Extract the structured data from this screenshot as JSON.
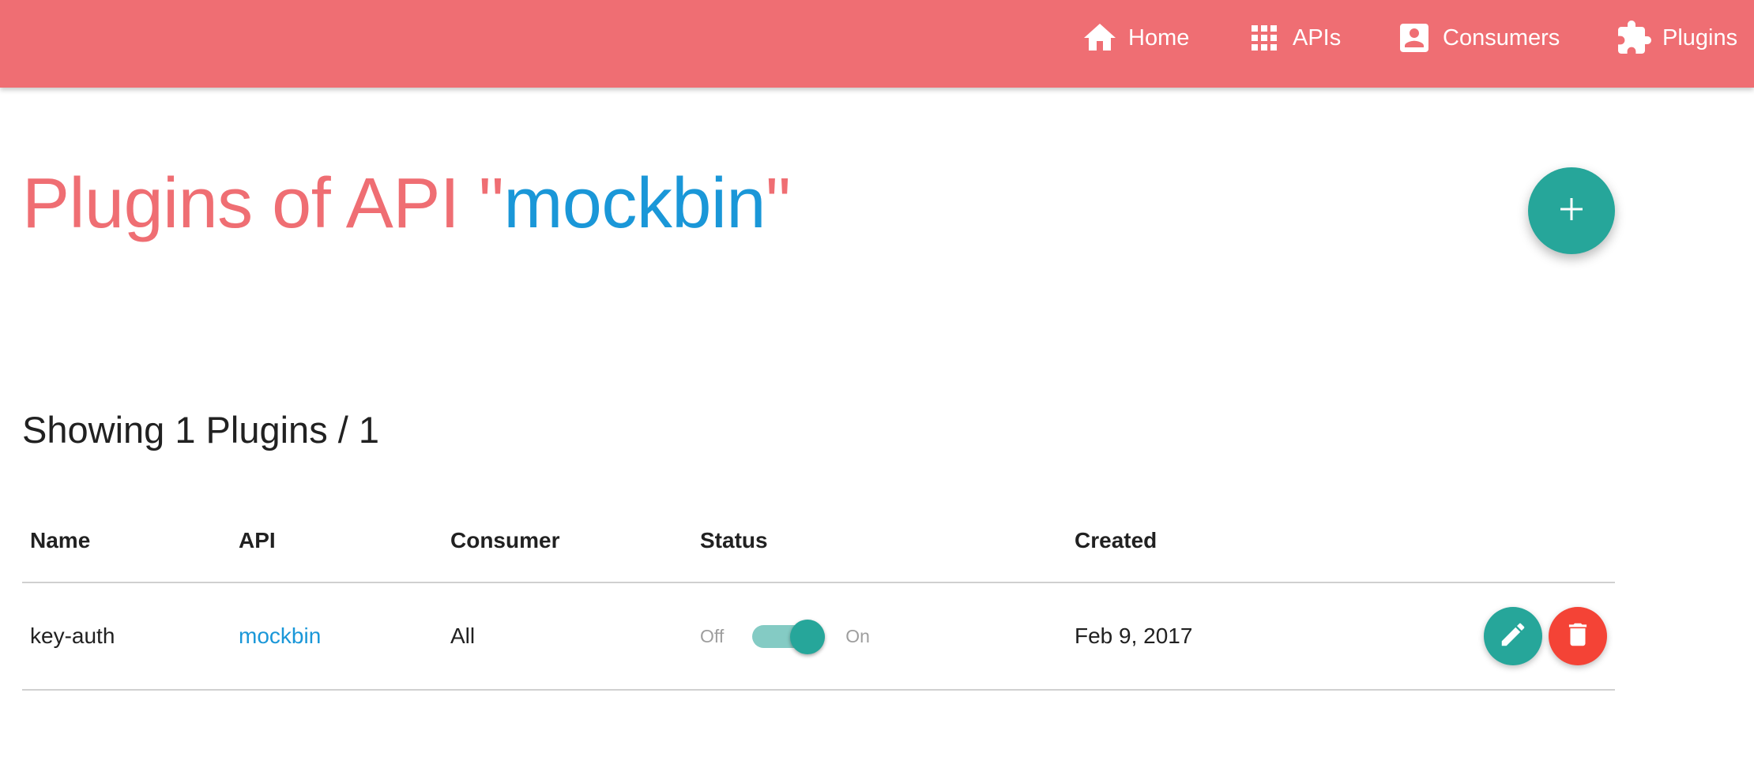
{
  "nav": {
    "items": [
      {
        "label": "Home",
        "icon": "home-icon"
      },
      {
        "label": "APIs",
        "icon": "apps-grid-icon"
      },
      {
        "label": "Consumers",
        "icon": "account-box-icon"
      },
      {
        "label": "Plugins",
        "icon": "puzzle-icon"
      }
    ]
  },
  "page": {
    "title_prefix": "Plugins of API \"",
    "api_name": "mockbin",
    "title_suffix": "\"",
    "add_button_icon": "plus-icon",
    "showing_text": "Showing 1 Plugins / 1"
  },
  "table": {
    "headers": [
      "Name",
      "API",
      "Consumer",
      "Status",
      "Created"
    ],
    "rows": [
      {
        "name": "key-auth",
        "api": "mockbin",
        "consumer": "All",
        "status_off_label": "Off",
        "status_on_label": "On",
        "status_enabled": true,
        "created": "Feb 9, 2017"
      }
    ]
  },
  "colors": {
    "navbar": "#ef6e73",
    "title": "#ef6e73",
    "link": "#1a97d8",
    "accent": "#26a69a",
    "danger": "#f44336"
  }
}
